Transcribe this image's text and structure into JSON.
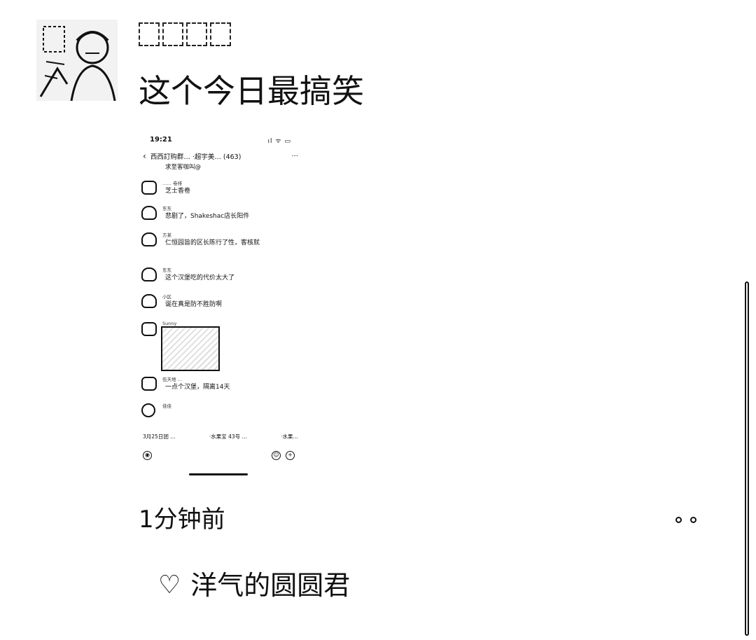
{
  "post": {
    "text": "这个今日最搞笑",
    "time": "1分钟前"
  },
  "screenshot": {
    "status_time": "19:21",
    "status_right": "ıl ᯤ ▭",
    "chat_title": "西西訂购群…  ·超宇美…  (463)",
    "more": "···",
    "first_line": "求至客咖叫@",
    "messages": [
      {
        "name": "…… 卷排",
        "text": "芝士香卷"
      },
      {
        "name": "东东",
        "text": "悲剧了，Shakeshac店长阳件"
      },
      {
        "name": "方某",
        "text": "仁恒园旨的区长陈行了性，客核就"
      },
      {
        "name": "东东",
        "text": "这个汉堡吃的代价太大了"
      },
      {
        "name": "小区",
        "text": "诞在真是防不胜防啊"
      },
      {
        "name": "Sunny",
        "text": ""
      },
      {
        "name": "伍天地 …",
        "text": "一点个汉堡，隔离14天"
      },
      {
        "name": "佳佳",
        "text": ""
      }
    ],
    "bottom_items": [
      "3月25日团 …",
      "·水果宝 43号 …",
      "·水果…"
    ]
  },
  "likes": {
    "names": "洋气的圆圆君"
  },
  "icons": {
    "heart": "heart-outline-icon",
    "more": "more-dots-icon"
  }
}
